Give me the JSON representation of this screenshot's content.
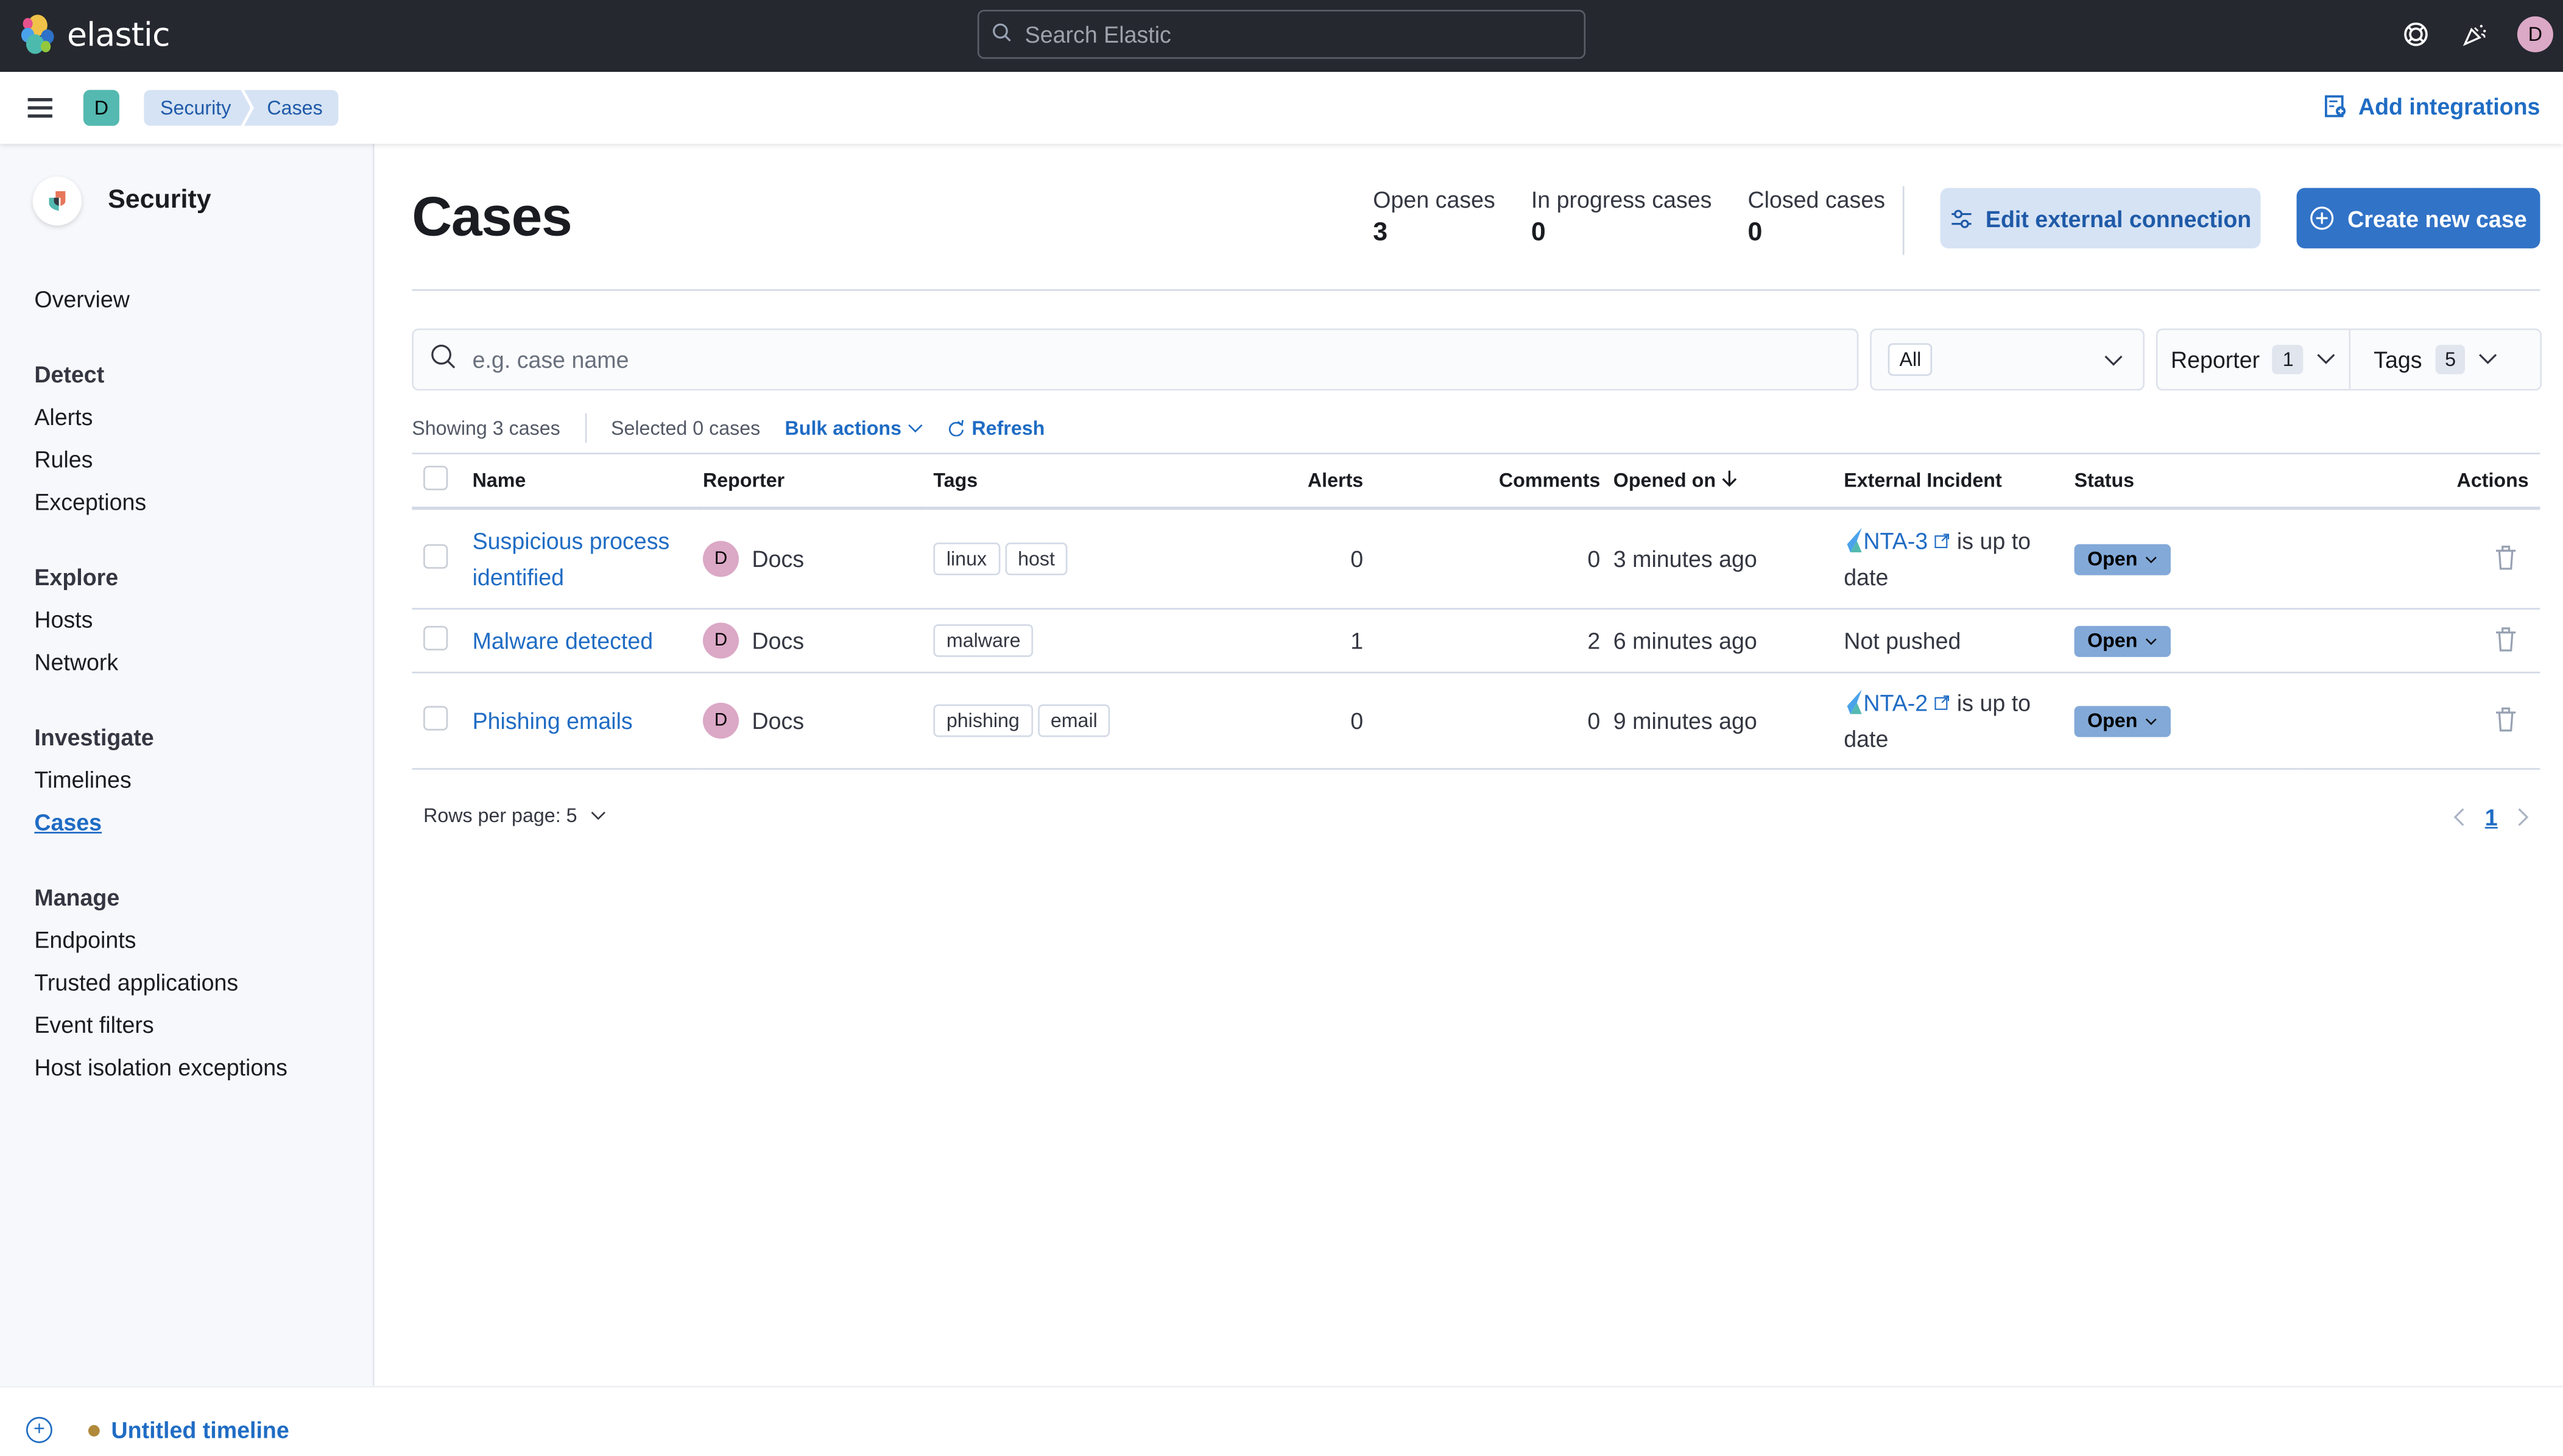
{
  "header": {
    "brand": "elastic",
    "search_placeholder": "Search Elastic",
    "icons": [
      "help-icon",
      "news-icon"
    ],
    "user_initial": "D"
  },
  "subbar": {
    "space_initial": "D",
    "breadcrumbs": [
      "Security",
      "Cases"
    ],
    "add_integrations": "Add integrations"
  },
  "sidebar": {
    "title": "Security",
    "overview": "Overview",
    "sections": [
      {
        "title": "Detect",
        "items": [
          "Alerts",
          "Rules",
          "Exceptions"
        ]
      },
      {
        "title": "Explore",
        "items": [
          "Hosts",
          "Network"
        ]
      },
      {
        "title": "Investigate",
        "items": [
          "Timelines",
          "Cases"
        ]
      },
      {
        "title": "Manage",
        "items": [
          "Endpoints",
          "Trusted applications",
          "Event filters",
          "Host isolation exceptions"
        ]
      }
    ],
    "active_item": "Cases"
  },
  "page": {
    "title": "Cases",
    "stats": [
      {
        "label": "Open cases",
        "value": "3"
      },
      {
        "label": "In progress cases",
        "value": "0"
      },
      {
        "label": "Closed cases",
        "value": "0"
      }
    ],
    "edit_connection": "Edit external connection",
    "create_case": "Create new case"
  },
  "filters": {
    "search_placeholder": "e.g. case name",
    "status_selected": "All",
    "reporter_label": "Reporter",
    "reporter_count": "1",
    "tags_label": "Tags",
    "tags_count": "5"
  },
  "toolbar": {
    "showing": "Showing 3 cases",
    "selected": "Selected 0 cases",
    "bulk_actions": "Bulk actions",
    "refresh": "Refresh"
  },
  "table": {
    "columns": [
      "Name",
      "Reporter",
      "Tags",
      "Alerts",
      "Comments",
      "Opened on",
      "External Incident",
      "Status",
      "Actions"
    ],
    "rows": [
      {
        "name": "Suspicious process identified",
        "reporter_initial": "D",
        "reporter": "Docs",
        "tags": [
          "linux",
          "host"
        ],
        "alerts": "0",
        "comments": "0",
        "opened": "3 minutes ago",
        "incident_link": "NTA-3",
        "incident_text": "is up to date",
        "status": "Open"
      },
      {
        "name": "Malware detected",
        "reporter_initial": "D",
        "reporter": "Docs",
        "tags": [
          "malware"
        ],
        "alerts": "1",
        "comments": "2",
        "opened": "6 minutes ago",
        "incident_link": "",
        "incident_text": "Not pushed",
        "status": "Open"
      },
      {
        "name": "Phishing emails",
        "reporter_initial": "D",
        "reporter": "Docs",
        "tags": [
          "phishing",
          "email"
        ],
        "alerts": "0",
        "comments": "0",
        "opened": "9 minutes ago",
        "incident_link": "NTA-2",
        "incident_text": "is up to date",
        "status": "Open"
      }
    ]
  },
  "pagination": {
    "rows_per_page": "Rows per page: 5",
    "current_page": "1"
  },
  "timeline": {
    "name": "Untitled timeline"
  },
  "colors": {
    "header_bg": "#25282f",
    "primary": "#3173c7",
    "link": "#1f6cc4",
    "status_open": "#82a9d8",
    "avatar": "#dba8c6",
    "space": "#54b9b0"
  }
}
